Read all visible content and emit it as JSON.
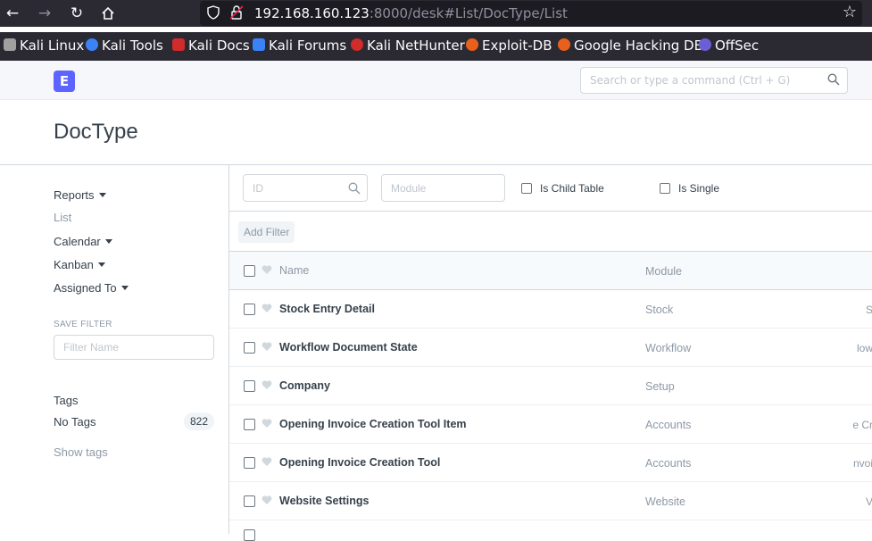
{
  "browser": {
    "url_host": "192.168.160.123",
    "url_rest": ":8000/desk#List/DocType/List",
    "bookmarks": [
      {
        "label": "Kali Linux",
        "icon": "kali-dragon-icon",
        "color": "#a0a0a0"
      },
      {
        "label": "Kali Tools",
        "icon": "kali-tools-icon",
        "color": "#3b82f6"
      },
      {
        "label": "Kali Docs",
        "icon": "kali-docs-icon",
        "color": "#d12b2b"
      },
      {
        "label": "Kali Forums",
        "icon": "kali-forums-icon",
        "color": "#3b82f6"
      },
      {
        "label": "Kali NetHunter",
        "icon": "nethunter-icon",
        "color": "#d12b2b"
      },
      {
        "label": "Exploit-DB",
        "icon": "exploit-db-icon",
        "color": "#e8601c"
      },
      {
        "label": "Google Hacking DB",
        "icon": "ghdb-icon",
        "color": "#e8601c"
      },
      {
        "label": "OffSec",
        "icon": "offsec-icon",
        "color": "#6b5fd6"
      }
    ]
  },
  "app": {
    "logo_letter": "E",
    "search_placeholder": "Search or type a command (Ctrl + G)",
    "accent": "#5e64ff"
  },
  "page": {
    "title": "DocType"
  },
  "sidebar": {
    "reports": "Reports",
    "list": "List",
    "calendar": "Calendar",
    "kanban": "Kanban",
    "assigned_to": "Assigned To",
    "save_filter_label": "SAVE FILTER",
    "filter_name_placeholder": "Filter Name",
    "tags_label": "Tags",
    "no_tags": "No Tags",
    "no_tags_count": "822",
    "show_tags": "Show tags"
  },
  "filters": {
    "id_placeholder": "ID",
    "module_placeholder": "Module",
    "is_child_table": "Is Child Table",
    "is_single": "Is Single",
    "add_filter": "Add Filter"
  },
  "list": {
    "header": {
      "name": "Name",
      "module": "Module"
    },
    "rows": [
      {
        "name": "Stock Entry Detail",
        "module": "Stock",
        "extra": "S"
      },
      {
        "name": "Workflow Document State",
        "module": "Workflow",
        "extra": "low"
      },
      {
        "name": "Company",
        "module": "Setup",
        "extra": ""
      },
      {
        "name": "Opening Invoice Creation Tool Item",
        "module": "Accounts",
        "extra": "e Cr"
      },
      {
        "name": "Opening Invoice Creation Tool",
        "module": "Accounts",
        "extra": "nvoi"
      },
      {
        "name": "Website Settings",
        "module": "Website",
        "extra": "V"
      }
    ]
  }
}
